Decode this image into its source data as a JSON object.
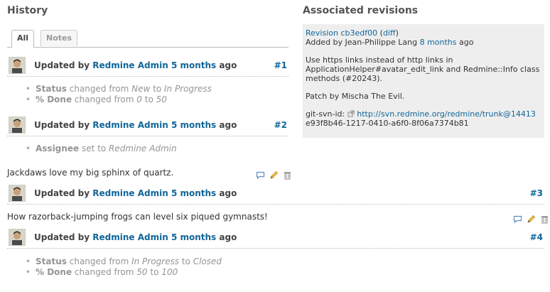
{
  "history_title": "History",
  "assoc_title": "Associated revisions",
  "tabs": [
    {
      "label": "All",
      "active": true
    },
    {
      "label": "Notes",
      "active": false
    }
  ],
  "journals": [
    {
      "prefix": "Updated by",
      "author": "Redmine Admin",
      "time": "5 months",
      "suffix": "ago",
      "number": "#1"
    },
    {
      "prefix": "Updated by",
      "author": "Redmine Admin",
      "time": "5 months",
      "suffix": "ago",
      "number": "#2"
    },
    {
      "prefix": "Updated by",
      "author": "Redmine Admin",
      "time": "5 months",
      "suffix": "ago",
      "number": "#3"
    },
    {
      "prefix": "Updated by",
      "author": "Redmine Admin",
      "time": "5 months",
      "suffix": "ago",
      "number": "#4"
    }
  ],
  "details": {
    "j1": [
      {
        "field": "Status",
        "t1": "changed from",
        "v1": "New",
        "t2": "to",
        "v2": "In Progress"
      },
      {
        "field": "% Done",
        "t1": "changed from",
        "v1": "0",
        "t2": "to",
        "v2": "50"
      }
    ],
    "j2": [
      {
        "field": "Assignee",
        "t1": "set to",
        "v1": "Redmine Admin"
      }
    ],
    "j4": [
      {
        "field": "Status",
        "t1": "changed from",
        "v1": "In Progress",
        "t2": "to",
        "v2": "Closed"
      },
      {
        "field": "% Done",
        "t1": "changed from",
        "v1": "50",
        "t2": "to",
        "v2": "100"
      }
    ]
  },
  "notes": [
    "Jackdaws love my big sphinx of quartz.",
    "How razorback-jumping frogs can level six piqued gymnasts!"
  ],
  "icons": {
    "quote": "quote-icon",
    "edit": "edit-icon",
    "delete": "delete-icon"
  },
  "revision": {
    "label": "Revision",
    "id": "cb3edf00",
    "diff": "diff",
    "added_prefix": "Added by",
    "author": "Jean-Philippe Lang",
    "time": "8 months",
    "time_suffix": "ago",
    "message1": "Use https links instead of http links in ApplicationHelper#avatar_edit_link and Redmine::Info class methods (#20243).",
    "message2": "Patch by Mischa The Evil.",
    "svn_label": "git-svn-id:",
    "svn_url": "http://svn.redmine.org/redmine/trunk@14413",
    "svn_uuid": "e93f8b46-1217-0410-a6f0-8f06a7374b81"
  },
  "colors": {
    "link": "#116699",
    "box": "#eeeeee"
  }
}
